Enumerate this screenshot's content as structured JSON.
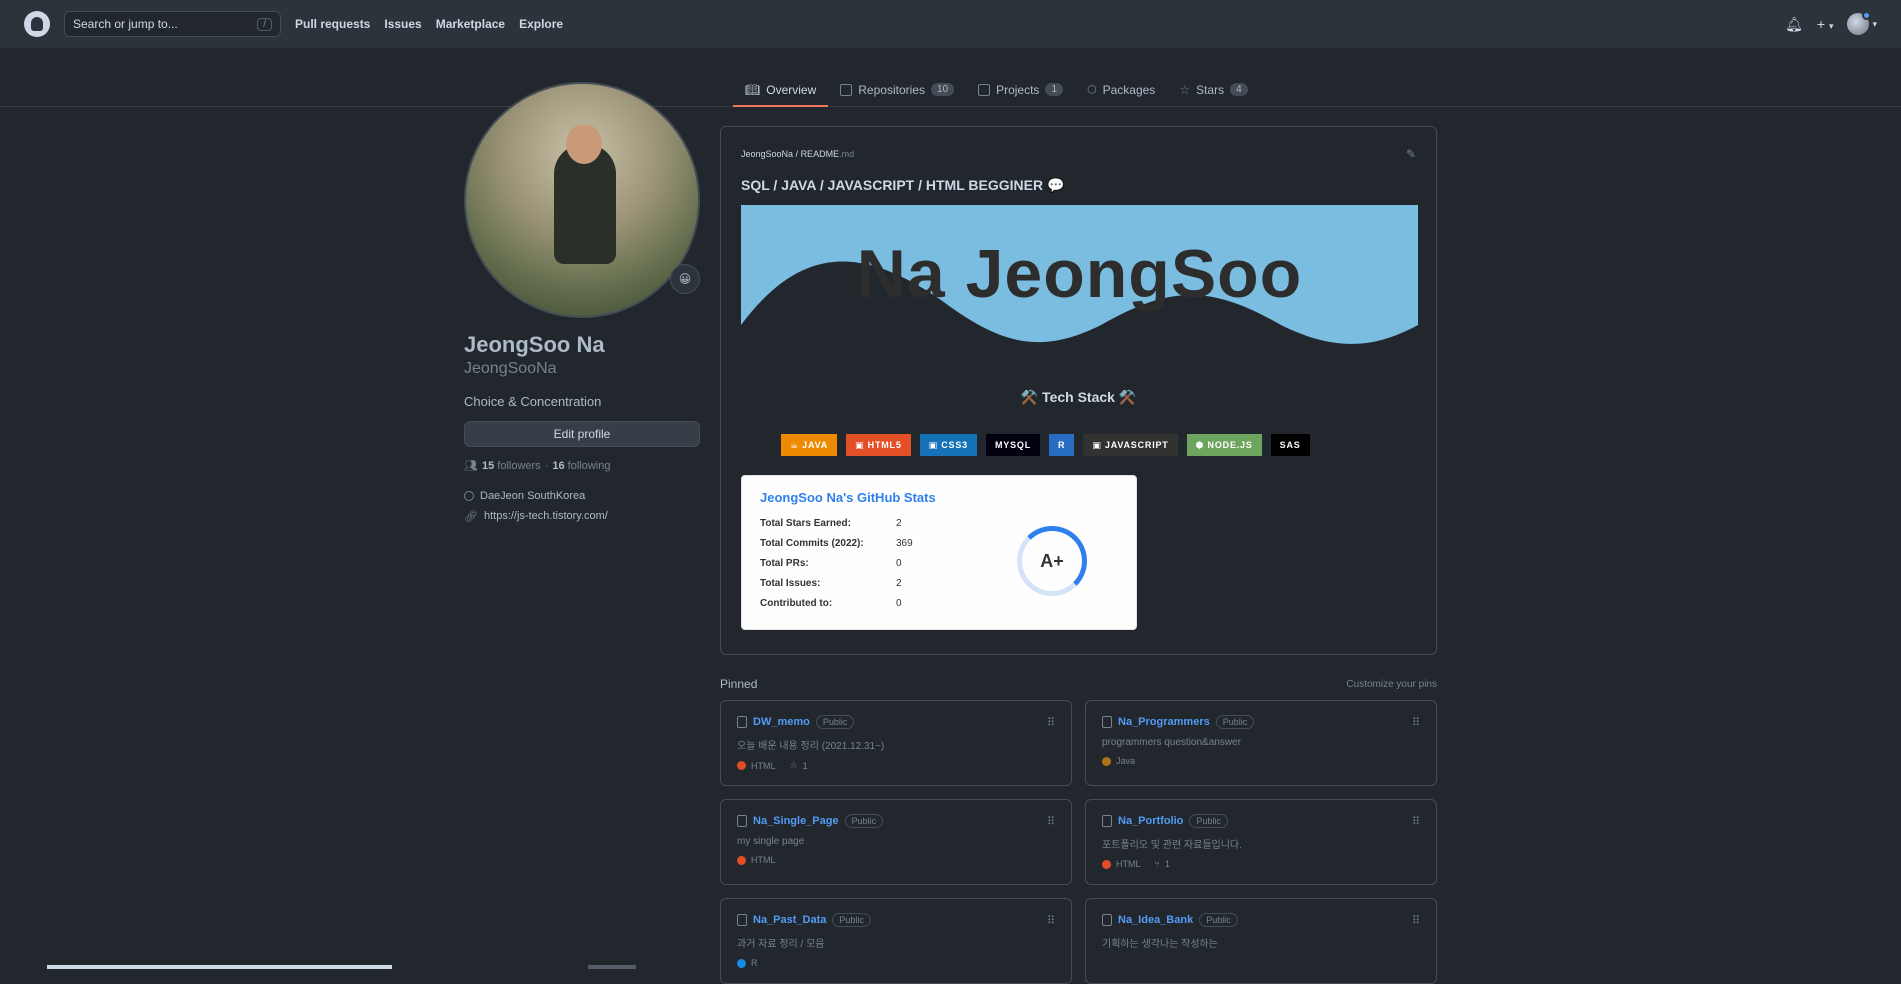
{
  "header": {
    "search_placeholder": "Search or jump to...",
    "search_shortcut": "/",
    "nav": [
      "Pull requests",
      "Issues",
      "Marketplace",
      "Explore"
    ],
    "plus": "+"
  },
  "tabs": [
    {
      "label": "Overview",
      "count": "",
      "icon": "book-icon"
    },
    {
      "label": "Repositories",
      "count": "10",
      "icon": "repo-icon"
    },
    {
      "label": "Projects",
      "count": "1",
      "icon": "project-icon"
    },
    {
      "label": "Packages",
      "count": "",
      "icon": "package-icon"
    },
    {
      "label": "Stars",
      "count": "4",
      "icon": "star-icon"
    }
  ],
  "profile": {
    "name": "JeongSoo Na",
    "login": "JeongSooNa",
    "bio": "Choice & Concentration",
    "edit_label": "Edit profile",
    "followers": "15",
    "followers_label": "followers",
    "separator": "·",
    "following": "16",
    "following_label": "following",
    "location": "DaeJeon SouthKorea",
    "website": "https://js-tech.tistory.com/",
    "status_emoji": "😀"
  },
  "readme": {
    "path_owner": "JeongSooNa",
    "path_sep": " / ",
    "path_file": "README",
    "path_ext": ".md",
    "title": "SQL / JAVA / JAVASCRIPT / HTML BEGGINER 💬",
    "banner_text": "Na JeongSoo",
    "tech_stack": "⚒️ Tech Stack ⚒️",
    "badges": [
      {
        "label": "☕ JAVA",
        "color": "#ed8b00"
      },
      {
        "label": "▣ HTML5",
        "color": "#e34f26"
      },
      {
        "label": "▣ CSS3",
        "color": "#1572b6"
      },
      {
        "label": "MYSQL",
        "color": "#00000f"
      },
      {
        "label": "R",
        "color": "#276dc3"
      },
      {
        "label": "▣ JAVASCRIPT",
        "color": "#323330"
      },
      {
        "label": "⬢ NODE.JS",
        "color": "#6da55f"
      },
      {
        "label": "SAS",
        "color": "#000000"
      }
    ],
    "stats": {
      "title": "JeongSoo Na's GitHub Stats",
      "rows": [
        {
          "label": "Total Stars Earned:",
          "value": "2"
        },
        {
          "label": "Total Commits (2022):",
          "value": "369"
        },
        {
          "label": "Total PRs:",
          "value": "0"
        },
        {
          "label": "Total Issues:",
          "value": "2"
        },
        {
          "label": "Contributed to:",
          "value": "0"
        }
      ],
      "grade": "A+"
    }
  },
  "pinned": {
    "title": "Pinned",
    "customize": "Customize your pins",
    "repos": [
      {
        "name": "DW_memo",
        "visibility": "Public",
        "desc": "오늘 배운 내용 정리 (2021.12.31~)",
        "lang": "HTML",
        "lang_color": "#e34c26",
        "stars": "1",
        "forks": ""
      },
      {
        "name": "Na_Programmers",
        "visibility": "Public",
        "desc": "programmers question&answer",
        "lang": "Java",
        "lang_color": "#b07219",
        "stars": "",
        "forks": ""
      },
      {
        "name": "Na_Single_Page",
        "visibility": "Public",
        "desc": "my single page",
        "lang": "HTML",
        "lang_color": "#e34c26",
        "stars": "",
        "forks": ""
      },
      {
        "name": "Na_Portfolio",
        "visibility": "Public",
        "desc": "포트폴리오 및 관련 자료들입니다.",
        "lang": "HTML",
        "lang_color": "#e34c26",
        "stars": "",
        "forks": "1"
      },
      {
        "name": "Na_Past_Data",
        "visibility": "Public",
        "desc": "과거 자료 정리 / 모음",
        "lang": "R",
        "lang_color": "#198ce7",
        "stars": "",
        "forks": ""
      },
      {
        "name": "Na_Idea_Bank",
        "visibility": "Public",
        "desc": "기획하는 생각나는 작성하는",
        "lang": "",
        "lang_color": "",
        "stars": "",
        "forks": ""
      }
    ]
  }
}
